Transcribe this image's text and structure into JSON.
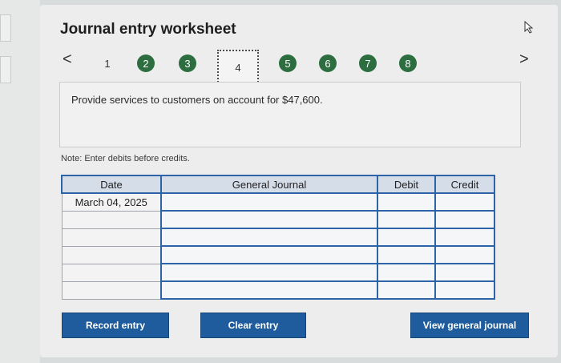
{
  "title": "Journal entry worksheet",
  "nav": {
    "prev_symbol": "<",
    "next_symbol": ">",
    "steps": [
      {
        "label": "1",
        "state": "plain"
      },
      {
        "label": "2",
        "state": "done"
      },
      {
        "label": "3",
        "state": "done"
      },
      {
        "label": "4",
        "state": "current"
      },
      {
        "label": "5",
        "state": "done"
      },
      {
        "label": "6",
        "state": "done"
      },
      {
        "label": "7",
        "state": "done"
      },
      {
        "label": "8",
        "state": "done"
      }
    ]
  },
  "prompt": "Provide services to customers on account for $47,600.",
  "note": "Note: Enter debits before credits.",
  "table": {
    "headers": [
      "Date",
      "General Journal",
      "Debit",
      "Credit"
    ],
    "rows": [
      {
        "date": "March 04, 2025",
        "account": "",
        "debit": "",
        "credit": ""
      },
      {
        "date": "",
        "account": "",
        "debit": "",
        "credit": ""
      },
      {
        "date": "",
        "account": "",
        "debit": "",
        "credit": ""
      },
      {
        "date": "",
        "account": "",
        "debit": "",
        "credit": ""
      },
      {
        "date": "",
        "account": "",
        "debit": "",
        "credit": ""
      },
      {
        "date": "",
        "account": "",
        "debit": "",
        "credit": ""
      }
    ]
  },
  "buttons": {
    "record": "Record entry",
    "clear": "Clear entry",
    "view": "View general journal"
  },
  "colors": {
    "accent": "#1f5c9d",
    "step_done": "#2c6e3f",
    "header_bg": "#d5dde9"
  }
}
